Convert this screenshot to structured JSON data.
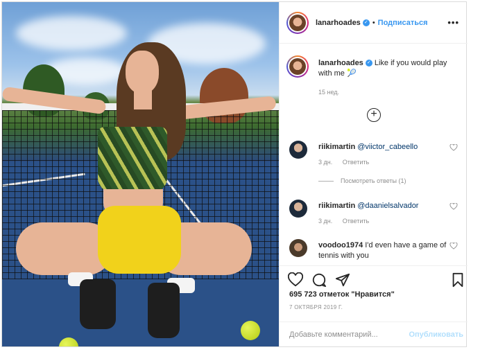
{
  "header": {
    "username": "lanarhoades",
    "separator": "•",
    "follow_label": "Подписаться",
    "more_label": "•••"
  },
  "caption": {
    "username": "lanarhoades",
    "text": "Like if you would play with me 🎾",
    "time": "15 нед."
  },
  "comments": [
    {
      "username": "riikimartin",
      "text": "@viictor_cabeello",
      "time": "3 дн.",
      "reply_label": "Ответить"
    },
    {
      "username": "riikimartin",
      "text": "@daanielsalvador",
      "time": "3 дн.",
      "reply_label": "Ответить"
    },
    {
      "username": "voodoo1974",
      "text": "I'd even have a game of tennis with you"
    }
  ],
  "view_replies": "Посмотреть ответы (1)",
  "likes": "695 723 отметок \"Нравится\"",
  "date": "7 ОКТЯБРЯ 2019 Г.",
  "add_comment": {
    "placeholder": "Добавьте комментарий...",
    "post_label": "Опубликовать"
  },
  "colors": {
    "accent": "#3897f0",
    "text": "#262626",
    "muted": "#8e8e8e",
    "post_disabled": "#b2dffc"
  }
}
